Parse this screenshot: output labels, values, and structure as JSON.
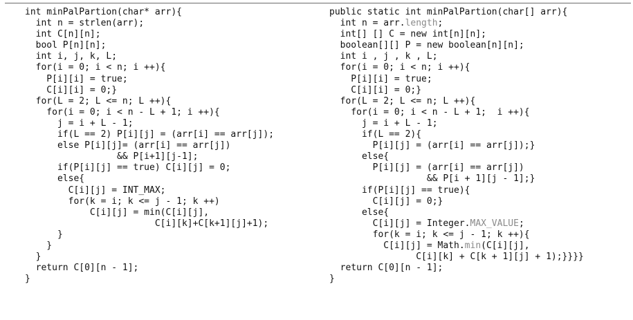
{
  "c_code": [
    "int minPalPartion(char* arr){",
    "  int n = strlen(arr);",
    "  int C[n][n];",
    "  bool P[n][n];",
    "  int i, j, k, L;",
    "  for(i = 0; i < n; i ++){",
    "    P[i][i] = true;",
    "    C[i][i] = 0;}",
    "  for(L = 2; L <= n; L ++){",
    "    for(i = 0; i < n - L + 1; i ++){",
    "      j = i + L - 1;",
    "      if(L == 2) P[i][j] = (arr[i] == arr[j]);",
    "      else P[i][j]= (arr[i] == arr[j])",
    "                 && P[i+1][j-1];",
    "      if(P[i][j] == true) C[i][j] = 0;",
    "      else{",
    "        C[i][j] = INT_MAX;",
    "        for(k = i; k <= j - 1; k ++)",
    "            C[i][j] = min(C[i][j],",
    "                        C[i][k]+C[k+1][j]+1);",
    "      }",
    "    }",
    "  }",
    "  return C[0][n - 1];",
    "}"
  ],
  "java_code": [
    "public static int minPalPartion(char[] arr){",
    "  int n = arr.length;",
    "  int[] [] C = new int[n][n];",
    "  boolean[][] P = new boolean[n][n];",
    "  int i , j , k , L;",
    "  for(i = 0; i < n; i ++){",
    "    P[i][i] = true;",
    "    C[i][i] = 0;}",
    "  for(L = 2; L <= n; L ++){",
    "    for(i = 0; i < n - L + 1;  i ++){",
    "      j = i + L - 1;",
    "      if(L == 2){",
    "        P[i][j] = (arr[i] == arr[j]);}",
    "      else{",
    "        P[i][j] = (arr[i] == arr[j])",
    "                  && P[i + 1][j - 1];}",
    "      if(P[i][j] == true){",
    "        C[i][j] = 0;}",
    "      else{",
    "        C[i][j] = Integer.MAX_VALUE;",
    "        for(k = i; k <= j - 1; k ++){",
    "          C[i][j] = Math.min(C[i][j],",
    "                C[i][k] + C[k + 1][j] + 1);}}}}",
    "  return C[0][n - 1];",
    "}"
  ],
  "colors": {
    "text": "#111111",
    "dimmed": "#8a8a8a",
    "rule": "#6a6a6a",
    "background": "#ffffff"
  }
}
